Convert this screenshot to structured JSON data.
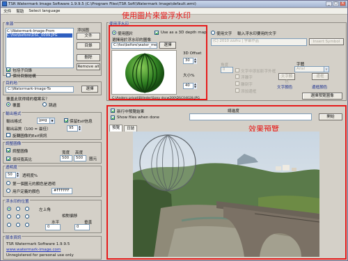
{
  "window": {
    "title": "TSR Watermark Image Software 1.9.9.5 (C:\\Program Files\\TSR Soft\\Watermark Image\\default.wmi)",
    "minimize": "_",
    "maximize": "□",
    "close": "X"
  },
  "menu": {
    "file": "文件",
    "help": "幫助",
    "language": "Select language"
  },
  "annotations": {
    "watermark_note": "使用圖片來當浮水印",
    "preview_note": "效果預覽",
    "red": "#e61919"
  },
  "source": {
    "label": "來源",
    "add_label": "添加圖",
    "files": [
      "C:\\Watermark-Image-From",
      "C:\\foo\\before\\DSC_0099.JPG"
    ],
    "file_btn": "文件",
    "folder_btn": "目錄",
    "delete_btn": "刪除",
    "remove_all_btn": "Remove all",
    "include_subdirs": "包括子目錄",
    "keep_structure": "保持目錄結構"
  },
  "output_dir": {
    "label": "目的地",
    "value": "C:\\Watermark-Image-To",
    "choose_btn": "選擇"
  },
  "overwrite": {
    "question": "覆蓋此就得總的檔案名？",
    "option_overwrite": "覆蓋",
    "option_skip": "跳過"
  },
  "output_format": {
    "label": "輸出格式",
    "format_label": "輸出格式",
    "format_value": "jpeg",
    "keep_exif": "保留Exif信息",
    "quality_label": "輸出品質（100 = 最佳）",
    "quality_value": "95",
    "rotate_exif": "旋轉圖像的Exif資訊"
  },
  "resize": {
    "label": "調整圖像",
    "enable": "調整圖像",
    "keep_ratio": "保持寬高比",
    "width_label": "寬度",
    "height_label": "高度",
    "width_value": "500",
    "height_value": "500",
    "unit": "圖元"
  },
  "transparency": {
    "label": "透明度",
    "value": "50",
    "opacity_label": "透明度%",
    "first_pixel": "第一個圖元的顏色是透明",
    "user_color": "用戶定義的顏色",
    "color_value": "#FFFFFF"
  },
  "position": {
    "label": "浮水印的位置",
    "selected": "左上角",
    "offset_label": "相對偏移",
    "horizontal": "水平",
    "vertical": "垂直",
    "h_value": "0",
    "v_value": "0"
  },
  "version": {
    "label": "版本資訊",
    "product": "TSR Watermark Software 1.9.9.5",
    "url": "www.watermark-image.com",
    "license": "Unregistered for personal use only"
  },
  "watermark": {
    "label": "使用浮水印",
    "use_image": "使用圖片",
    "use_3d": "Use as a 3D depth map",
    "choose_image_label": "選擇用於浮水印的圖像",
    "image_path": "C:\\foo\\before\\water_mel",
    "choose_btn": "選擇",
    "offset_label": "3D Offset",
    "offset_value": "30",
    "size_label": "大小%",
    "size_value": "40",
    "status_path": "C:\\Anders privat\\Billeder\\Sony dscw200\\DSC04028.JPG"
  },
  "text_wm": {
    "use_text": "使用文字",
    "enter_text_label": "輸入浮水印要用的文字",
    "text_placeholder": "(C) 2010 zzzhu | 字幕作品",
    "insert_symbol": "Insert Symbol",
    "angle_label": "角度",
    "angle_value": "0",
    "font_label": "字體",
    "font_value": "Arial",
    "opt1": "文字中添加影字外框",
    "opt2": "浮雕字",
    "opt3": "雕刻字",
    "opt4": "添加邊框",
    "color_btn": "文字顏色",
    "border_color_btn": "文字顏色",
    "border_btn": "邊框",
    "shadow_color_btn": "邊框顏色",
    "update_btn": "選擇預覽圖像"
  },
  "preview": {
    "new_in_preview": "新行中預覽結果",
    "show_files": "Show files when done",
    "progress_label": "總進度",
    "start_btn": "開始",
    "tab_preview": "預覽",
    "tab_log": "日誌"
  }
}
